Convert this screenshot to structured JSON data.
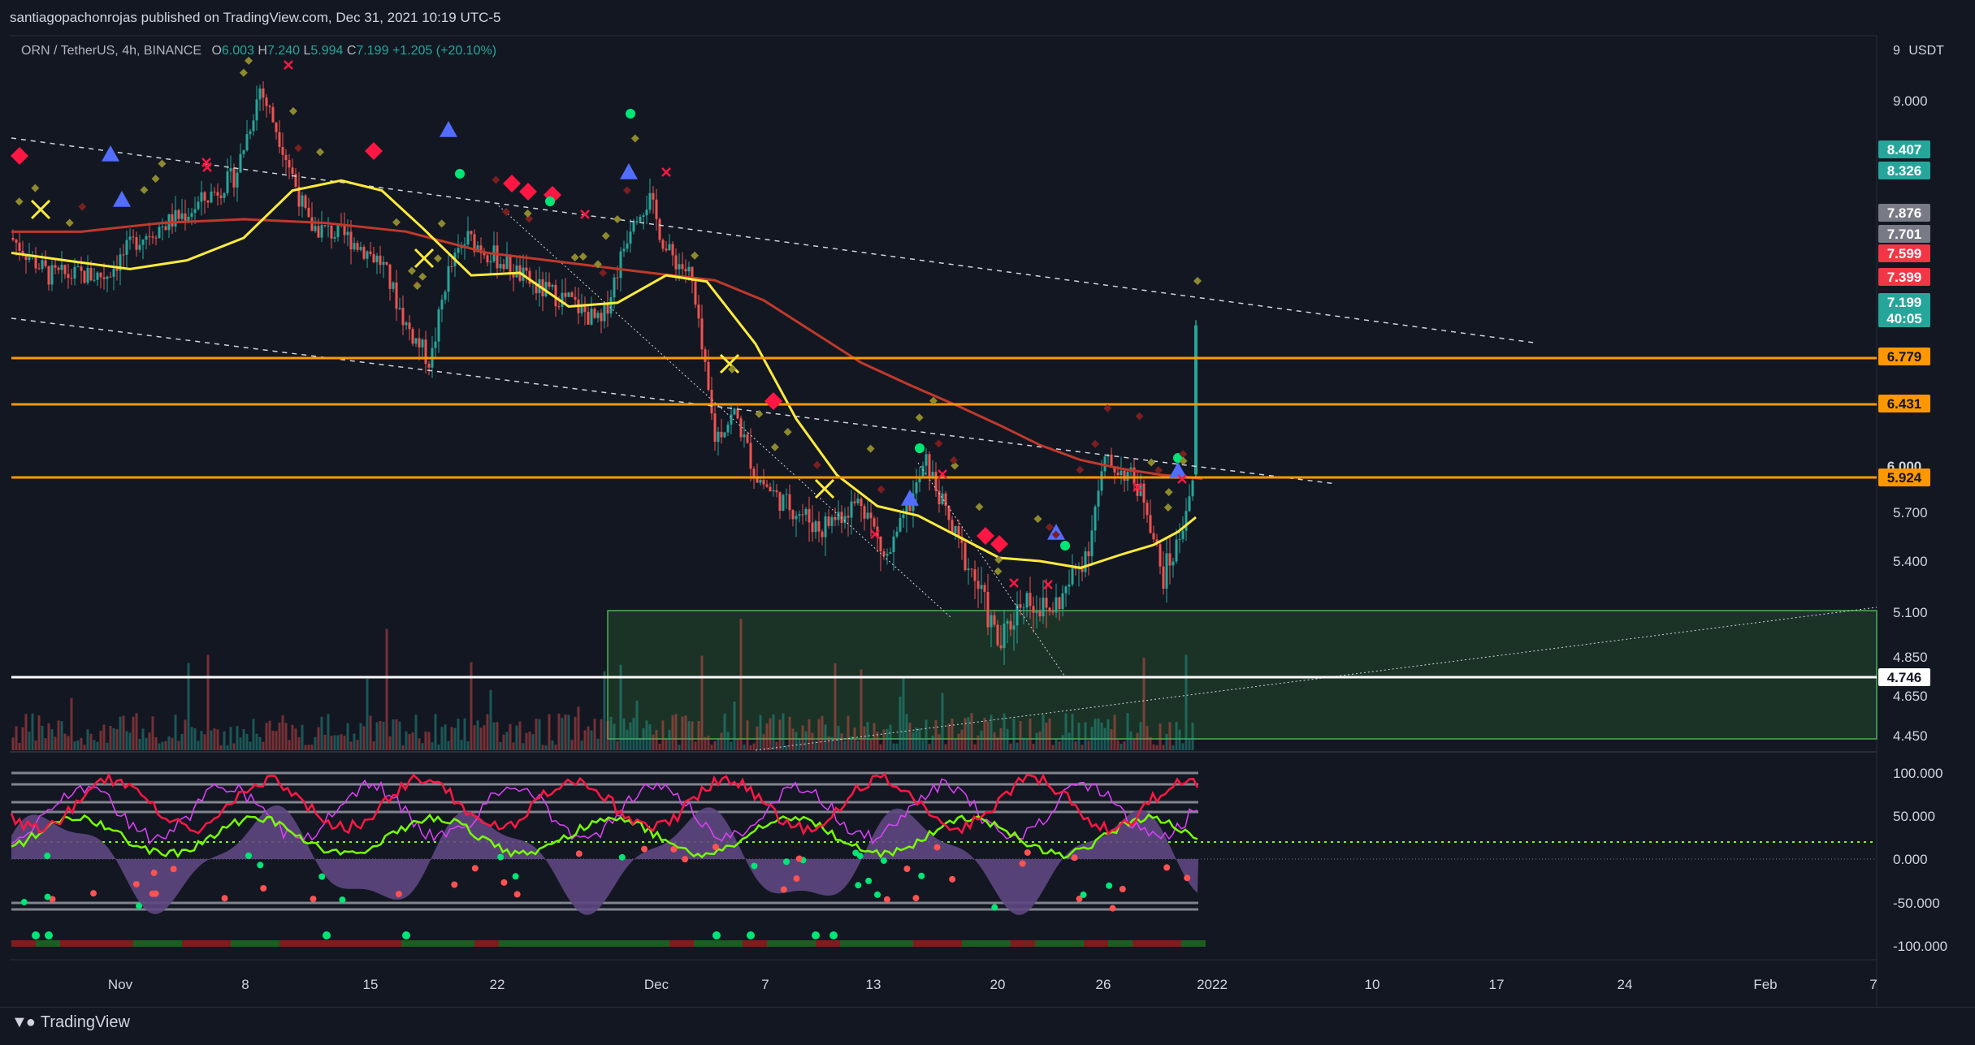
{
  "header": {
    "publish_text": "santiagopachonrojas published on TradingView.com, Dec 31, 2021 10:19 UTC-5"
  },
  "symbol": {
    "name": "ORN / TetherUS, 4h, BINANCE",
    "open_label": "O",
    "open": "6.003",
    "high_label": "H",
    "high": "7.240",
    "low_label": "L",
    "low": "5.994",
    "close_label": "C",
    "close": "7.199",
    "change": "+1.205 (+20.10%)",
    "currency": "USDT"
  },
  "price_axis": {
    "ticks": [
      "9.000",
      "5.700",
      "5.400",
      "5.100",
      "4.850",
      "4.650",
      "4.450"
    ],
    "partial_top": "9"
  },
  "price_labels": [
    {
      "text": "8.407",
      "color": "#26a69a"
    },
    {
      "text": "8.326",
      "color": "#26a69a"
    },
    {
      "text": "7.876",
      "color": "#787b86"
    },
    {
      "text": "7.701",
      "color": "#787b86"
    },
    {
      "text": "7.599",
      "color": "#f23645"
    },
    {
      "text": "7.399",
      "color": "#f23645"
    },
    {
      "text": "7.199",
      "color": "#26a69a"
    },
    {
      "text": "40:05",
      "color": "#26a69a"
    },
    {
      "text": "6.779",
      "color": "#ff9800"
    },
    {
      "text": "6.431",
      "color": "#ff9800"
    },
    {
      "text": "6.000",
      "color": "#131722"
    },
    {
      "text": "5.924",
      "color": "#ff9800"
    },
    {
      "text": "4.746",
      "color": "#ffffff"
    }
  ],
  "horizontal_levels": [
    {
      "price": 6.779,
      "color": "#ff9800"
    },
    {
      "price": 6.431,
      "color": "#ff9800"
    },
    {
      "price": 5.924,
      "color": "#ff9800"
    },
    {
      "price": 4.746,
      "color": "#ffffff"
    }
  ],
  "oscillator_axis": {
    "ticks": [
      "100.000",
      "50.000",
      "0.000",
      "-50.000",
      "-100.000"
    ]
  },
  "time_axis": {
    "ticks": [
      "Nov",
      "8",
      "15",
      "22",
      "Dec",
      "7",
      "13",
      "20",
      "26",
      "2022",
      "10",
      "17",
      "24",
      "Feb",
      "7"
    ]
  },
  "footer": {
    "brand": "TradingView"
  },
  "colors": {
    "background": "#131722",
    "up": "#26a69a",
    "down": "#ef5350",
    "ma_fast": "#ffeb3b",
    "ma_slow": "#c0392b",
    "level": "#ff9800",
    "zone": "#2e7d32"
  }
}
